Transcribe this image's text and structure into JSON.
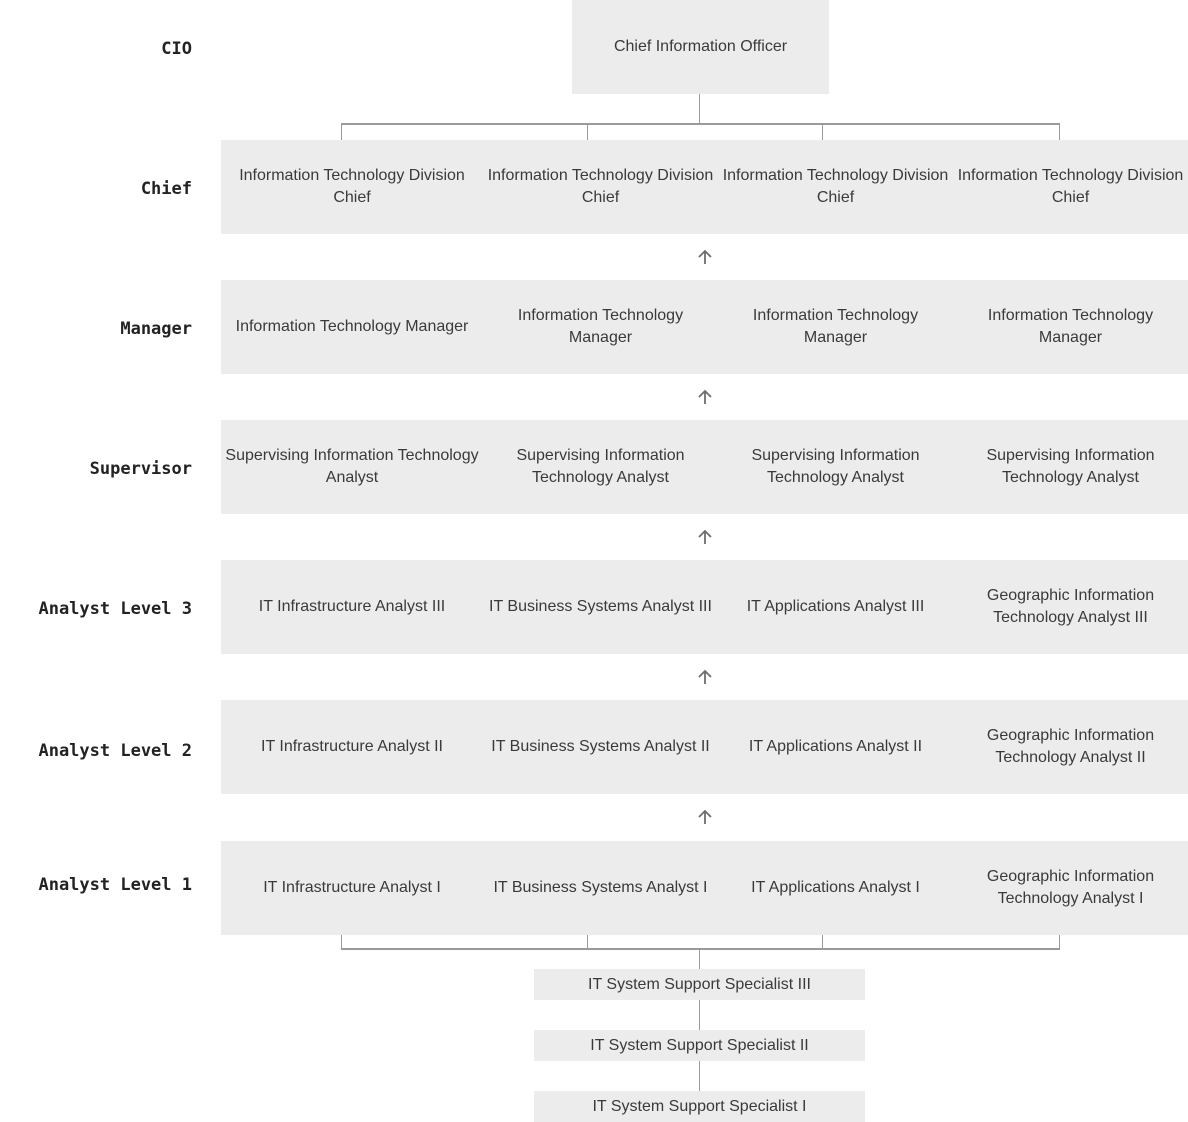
{
  "levels": [
    {
      "label": "CIO"
    },
    {
      "label": "Chief"
    },
    {
      "label": "Manager"
    },
    {
      "label": "Supervisor"
    },
    {
      "label": "Analyst Level 3"
    },
    {
      "label": "Analyst Level 2"
    },
    {
      "label": "Analyst Level 1"
    }
  ],
  "cio": {
    "title": "Chief Information Officer"
  },
  "rows": [
    {
      "positions": [
        "Information Technology Division Chief",
        "Information Technology Division Chief",
        "Information Technology Division Chief",
        "Information Technology Division Chief"
      ]
    },
    {
      "positions": [
        "Information Technology Manager",
        "Information Technology Manager",
        "Information Technology Manager",
        "Information Technology Manager"
      ]
    },
    {
      "positions": [
        "Supervising Information Technology Analyst",
        "Supervising Information Technology Analyst",
        "Supervising Information Technology Analyst",
        "Supervising Information Technology Analyst"
      ]
    },
    {
      "positions": [
        "IT Infrastructure Analyst III",
        "IT Business Systems Analyst III",
        "IT Applications Analyst III",
        "Geographic Information Technology Analyst III"
      ]
    },
    {
      "positions": [
        "IT Infrastructure Analyst II",
        "IT Business Systems Analyst II",
        "IT Applications Analyst II",
        "Geographic Information Technology Analyst II"
      ]
    },
    {
      "positions": [
        "IT Infrastructure Analyst I",
        "IT Business Systems Analyst I",
        "IT Applications Analyst I",
        "Geographic Information Technology Analyst I"
      ]
    }
  ],
  "support": [
    {
      "title": "IT System Support Specialist III"
    },
    {
      "title": "IT System Support Specialist II"
    },
    {
      "title": "IT System Support Specialist I"
    }
  ],
  "icons": {
    "arrow": "arrow-up-icon"
  }
}
